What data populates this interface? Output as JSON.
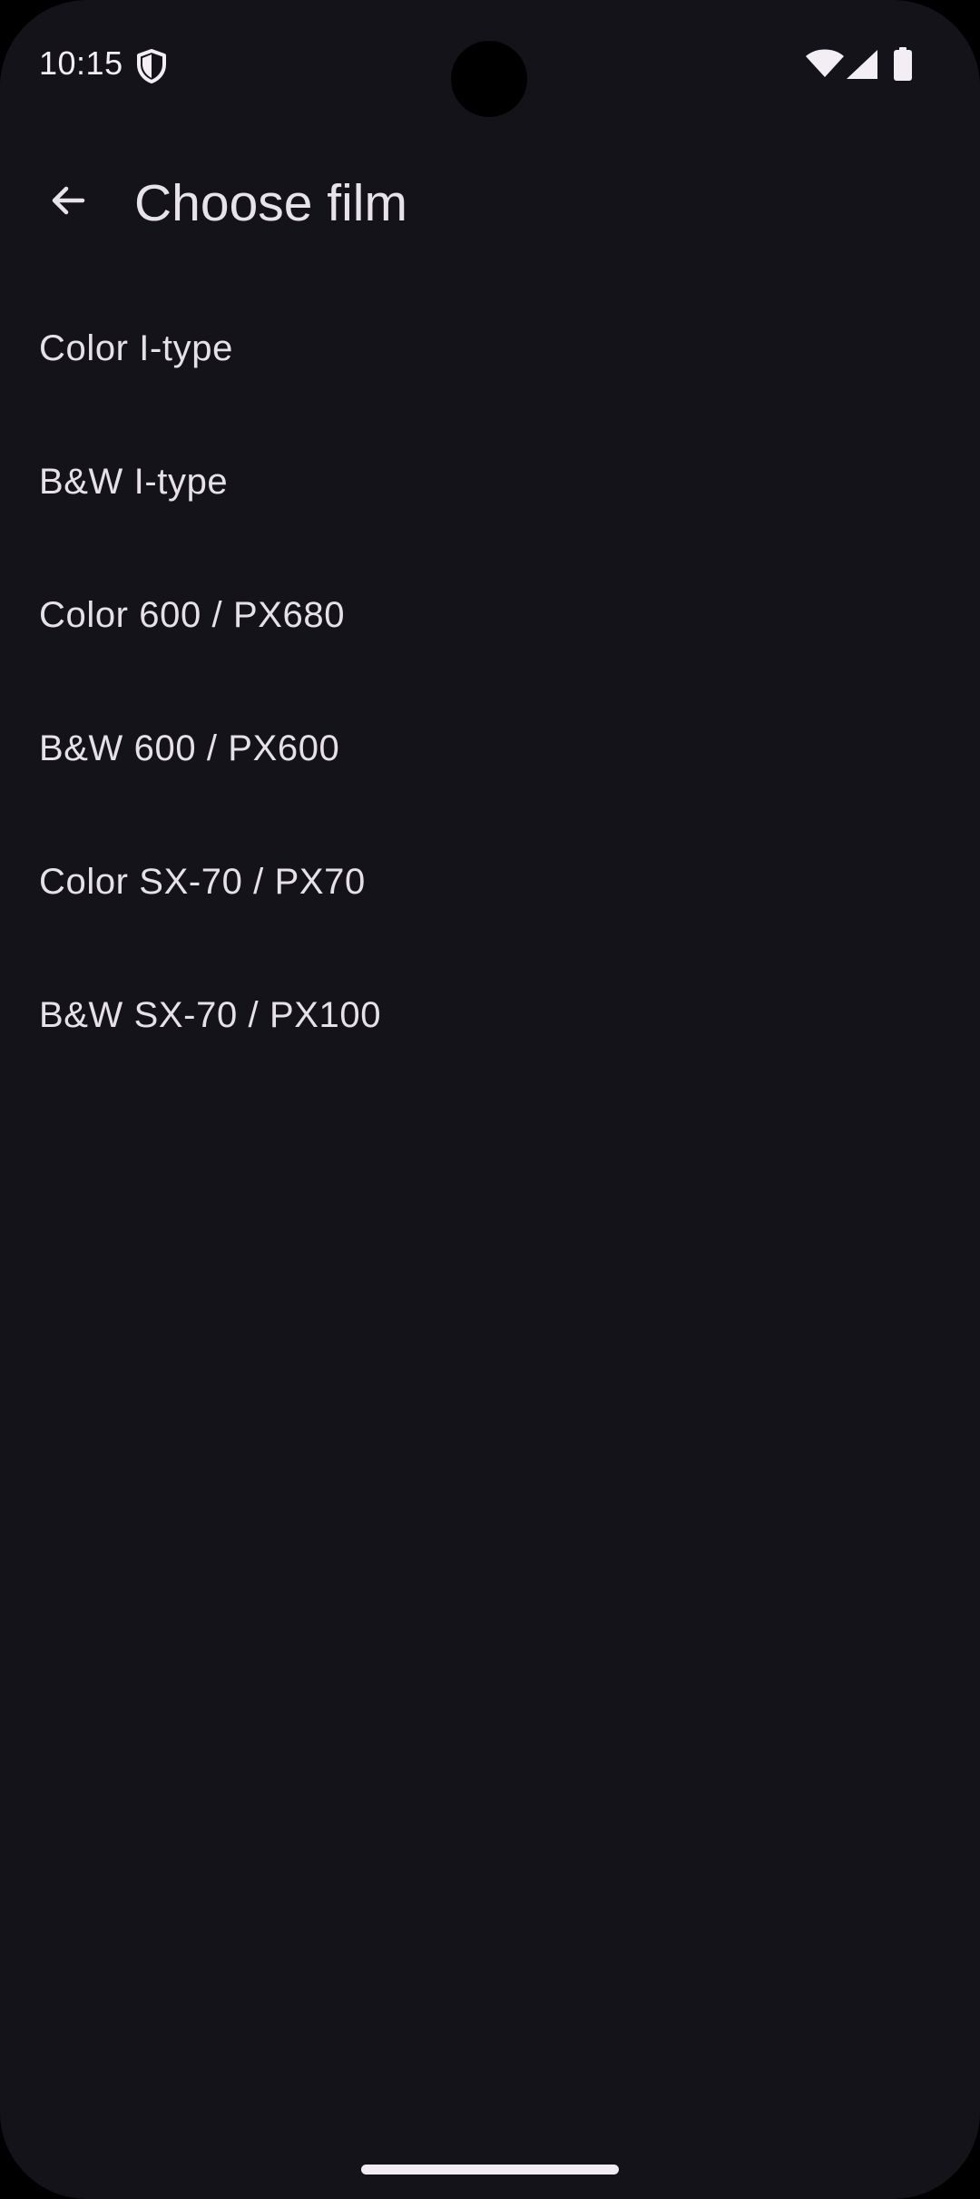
{
  "status_bar": {
    "time": "10:15",
    "icons": [
      "shield-icon",
      "wifi-icon",
      "signal-icon",
      "battery-icon"
    ]
  },
  "app_bar": {
    "back_icon": "arrow-back-icon",
    "title": "Choose film"
  },
  "film_options": [
    {
      "label": "Color I-type"
    },
    {
      "label": "B&W I-type"
    },
    {
      "label": "Color 600 / PX680"
    },
    {
      "label": "B&W 600 / PX600"
    },
    {
      "label": "Color SX-70 / PX70"
    },
    {
      "label": "B&W SX-70 / PX100"
    }
  ],
  "colors": {
    "background": "#15131a",
    "text": "#e6e1e6"
  }
}
